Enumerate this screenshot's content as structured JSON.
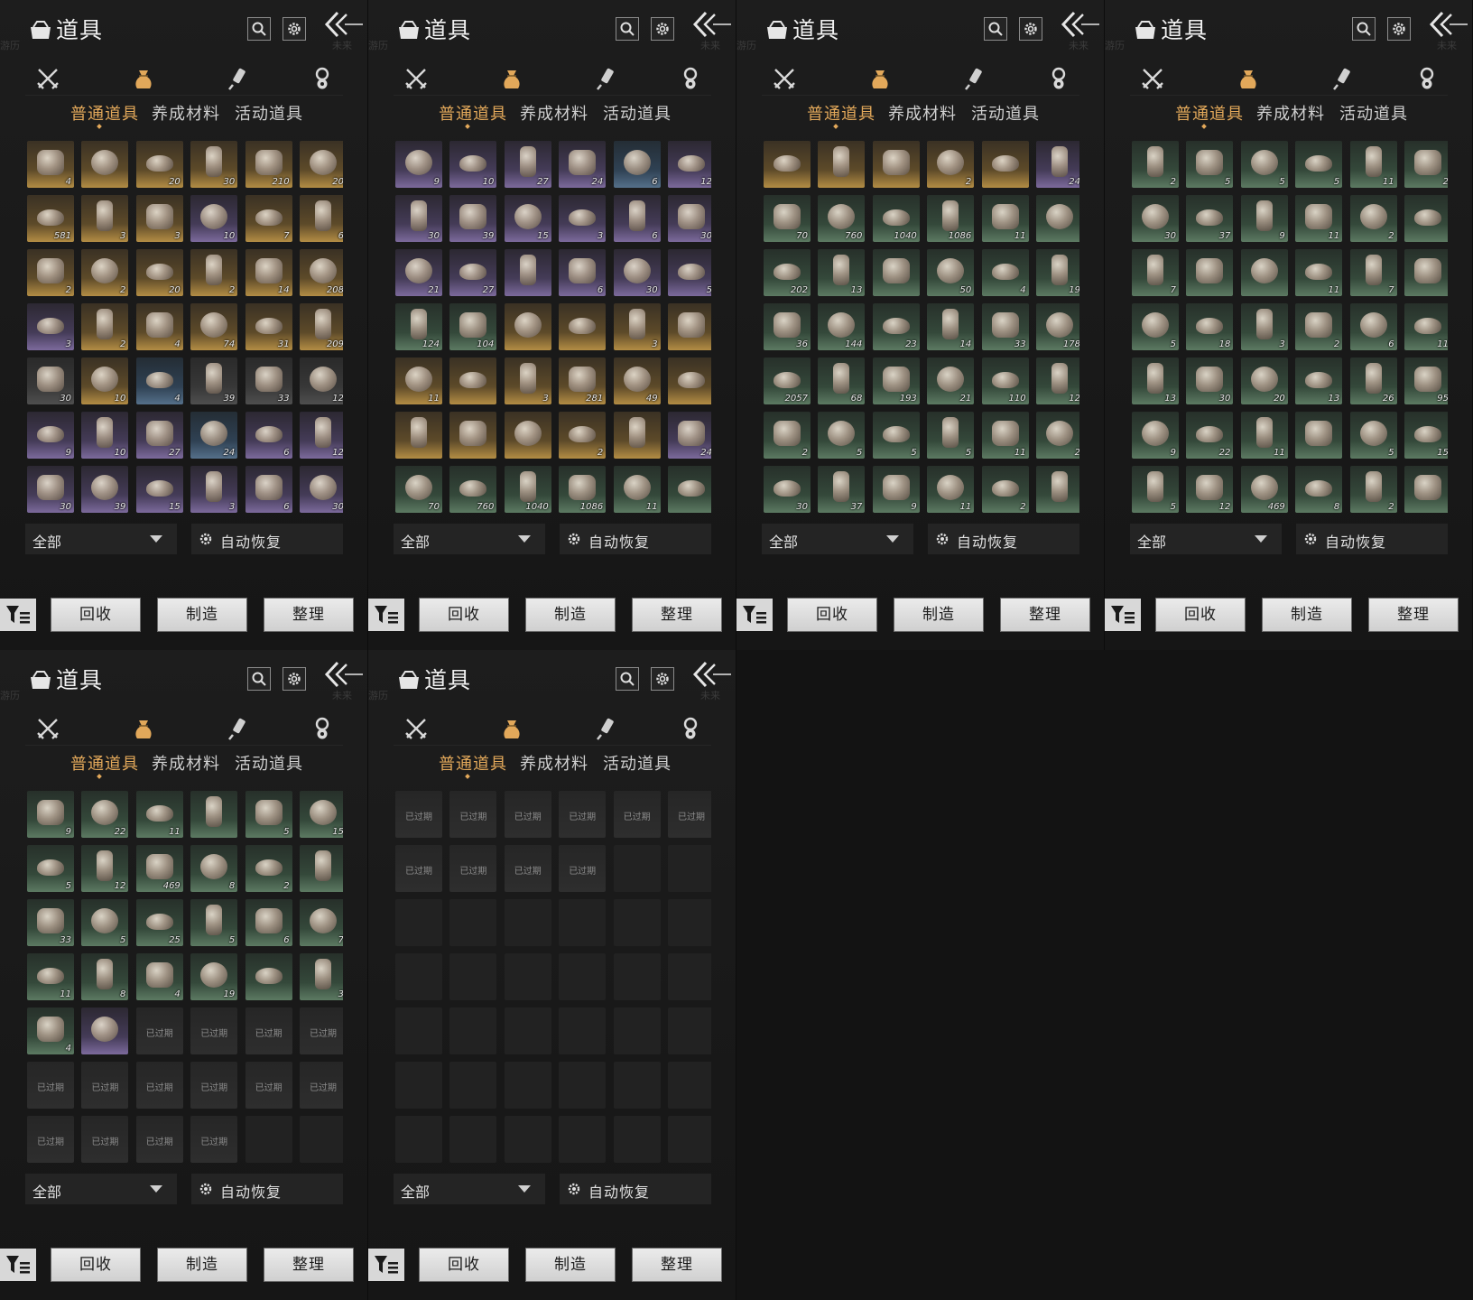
{
  "header": {
    "title": "道具",
    "faint_left": "游历",
    "faint_right": "未来"
  },
  "icons": {
    "bag": "bag-icon",
    "search": "search-icon",
    "settings": "gear-icon",
    "back": "double-chevron-left-icon",
    "cat_weapons": "crossed-swords-icon",
    "cat_items": "pouch-icon",
    "cat_scroll": "scroll-brush-icon",
    "cat_medal": "medal-icon",
    "filter": "filter-icon",
    "auto_recover": "gear-icon"
  },
  "subtabs": [
    "普通道具",
    "养成材料",
    "活动道具"
  ],
  "controls": {
    "dropdown_value": "全部",
    "auto_recover": "自动恢复"
  },
  "actions": {
    "recycle": "回收",
    "craft": "制造",
    "sort": "整理"
  },
  "expired_label": "已过期",
  "colors": {
    "accent": "#e2a85a",
    "rarity_gold": "#b38d44",
    "rarity_purple": "#7c6a9c",
    "rarity_green": "#5c7a62",
    "rarity_blue": "#55708a"
  },
  "panels": [
    {
      "rows": [
        [
          [
            "gold",
            "4"
          ],
          [
            "gold",
            ""
          ],
          [
            "gold",
            "20"
          ],
          [
            "gold",
            "30"
          ],
          [
            "gold",
            "210"
          ],
          [
            "gold",
            "20"
          ]
        ],
        [
          [
            "gold",
            "581"
          ],
          [
            "gold",
            "3"
          ],
          [
            "gold",
            "3"
          ],
          [
            "purple",
            "10"
          ],
          [
            "gold",
            "7"
          ],
          [
            "gold",
            "6"
          ]
        ],
        [
          [
            "gold",
            "2"
          ],
          [
            "gold",
            "2"
          ],
          [
            "gold",
            "20"
          ],
          [
            "gold",
            "2"
          ],
          [
            "gold",
            "14"
          ],
          [
            "gold",
            "208"
          ]
        ],
        [
          [
            "purple",
            "3"
          ],
          [
            "gold",
            "2"
          ],
          [
            "gold",
            "4"
          ],
          [
            "gold",
            "74"
          ],
          [
            "gold",
            "31"
          ],
          [
            "gold",
            "209"
          ]
        ],
        [
          [
            "grey",
            "30"
          ],
          [
            "gold",
            "10"
          ],
          [
            "blue",
            "4"
          ],
          [
            "grey",
            "39"
          ],
          [
            "grey",
            "33"
          ],
          [
            "grey",
            "12"
          ]
        ],
        [
          [
            "purple",
            "9"
          ],
          [
            "purple",
            "10"
          ],
          [
            "purple",
            "27"
          ],
          [
            "blue",
            "24"
          ],
          [
            "purple",
            "6"
          ],
          [
            "purple",
            "12"
          ]
        ],
        [
          [
            "purple",
            "30"
          ],
          [
            "purple",
            "39"
          ],
          [
            "purple",
            "15"
          ],
          [
            "purple",
            "3"
          ],
          [
            "purple",
            "6"
          ],
          [
            "purple",
            "30"
          ]
        ]
      ]
    },
    {
      "rows": [
        [
          [
            "purple",
            "9"
          ],
          [
            "purple",
            "10"
          ],
          [
            "purple",
            "27"
          ],
          [
            "purple",
            "24"
          ],
          [
            "blue",
            "6"
          ],
          [
            "purple",
            "12"
          ]
        ],
        [
          [
            "purple",
            "30"
          ],
          [
            "purple",
            "39"
          ],
          [
            "purple",
            "15"
          ],
          [
            "purple",
            "3"
          ],
          [
            "purple",
            "6"
          ],
          [
            "purple",
            "30"
          ]
        ],
        [
          [
            "purple",
            "21"
          ],
          [
            "purple",
            "27"
          ],
          [
            "purple",
            ""
          ],
          [
            "purple",
            "6"
          ],
          [
            "purple",
            "30"
          ],
          [
            "purple",
            "5"
          ]
        ],
        [
          [
            "green",
            "124"
          ],
          [
            "green",
            "104"
          ],
          [
            "gold",
            ""
          ],
          [
            "gold",
            ""
          ],
          [
            "gold",
            "3"
          ],
          [
            "gold",
            ""
          ]
        ],
        [
          [
            "gold",
            "11"
          ],
          [
            "gold",
            ""
          ],
          [
            "gold",
            "3"
          ],
          [
            "gold",
            "281"
          ],
          [
            "gold",
            "49"
          ],
          [
            "gold",
            ""
          ]
        ],
        [
          [
            "gold",
            ""
          ],
          [
            "gold",
            ""
          ],
          [
            "gold",
            ""
          ],
          [
            "gold",
            "2"
          ],
          [
            "gold",
            ""
          ],
          [
            "purple",
            "24"
          ]
        ],
        [
          [
            "green",
            "70"
          ],
          [
            "green",
            "760"
          ],
          [
            "green",
            "1040"
          ],
          [
            "green",
            "1086"
          ],
          [
            "green",
            "11"
          ],
          [
            "green",
            ""
          ]
        ]
      ]
    },
    {
      "rows": [
        [
          [
            "gold",
            ""
          ],
          [
            "gold",
            ""
          ],
          [
            "gold",
            ""
          ],
          [
            "gold",
            "2"
          ],
          [
            "gold",
            ""
          ],
          [
            "purple",
            "24"
          ]
        ],
        [
          [
            "green",
            "70"
          ],
          [
            "green",
            "760"
          ],
          [
            "green",
            "1040"
          ],
          [
            "green",
            "1086"
          ],
          [
            "green",
            "11"
          ],
          [
            "green",
            ""
          ]
        ],
        [
          [
            "green",
            "202"
          ],
          [
            "green",
            "13"
          ],
          [
            "green",
            ""
          ],
          [
            "green",
            "50"
          ],
          [
            "green",
            "4"
          ],
          [
            "green",
            "19"
          ]
        ],
        [
          [
            "green",
            "36"
          ],
          [
            "green",
            "144"
          ],
          [
            "green",
            "23"
          ],
          [
            "green",
            "14"
          ],
          [
            "green",
            "33"
          ],
          [
            "green",
            "178"
          ]
        ],
        [
          [
            "green",
            "2057"
          ],
          [
            "green",
            "68"
          ],
          [
            "green",
            "193"
          ],
          [
            "green",
            "21"
          ],
          [
            "green",
            "110"
          ],
          [
            "green",
            "12"
          ]
        ],
        [
          [
            "green",
            "2"
          ],
          [
            "green",
            "5"
          ],
          [
            "green",
            "5"
          ],
          [
            "green",
            "5"
          ],
          [
            "green",
            "11"
          ],
          [
            "green",
            "2"
          ]
        ],
        [
          [
            "green",
            "30"
          ],
          [
            "green",
            "37"
          ],
          [
            "green",
            "9"
          ],
          [
            "green",
            "11"
          ],
          [
            "green",
            "2"
          ],
          [
            "green",
            ""
          ]
        ]
      ]
    },
    {
      "rows": [
        [
          [
            "green",
            "2"
          ],
          [
            "green",
            "5"
          ],
          [
            "green",
            "5"
          ],
          [
            "green",
            "5"
          ],
          [
            "green",
            "11"
          ],
          [
            "green",
            "2"
          ]
        ],
        [
          [
            "green",
            "30"
          ],
          [
            "green",
            "37"
          ],
          [
            "green",
            "9"
          ],
          [
            "green",
            "11"
          ],
          [
            "green",
            "2"
          ],
          [
            "green",
            ""
          ]
        ],
        [
          [
            "green",
            "7"
          ],
          [
            "green",
            ""
          ],
          [
            "green",
            ""
          ],
          [
            "green",
            "11"
          ],
          [
            "green",
            "7"
          ],
          [
            "green",
            ""
          ]
        ],
        [
          [
            "green",
            "5"
          ],
          [
            "green",
            "18"
          ],
          [
            "green",
            "3"
          ],
          [
            "green",
            "2"
          ],
          [
            "green",
            "6"
          ],
          [
            "green",
            "11"
          ]
        ],
        [
          [
            "green",
            "13"
          ],
          [
            "green",
            "30"
          ],
          [
            "green",
            "20"
          ],
          [
            "green",
            "13"
          ],
          [
            "green",
            "26"
          ],
          [
            "green",
            "95"
          ]
        ],
        [
          [
            "green",
            "9"
          ],
          [
            "green",
            "22"
          ],
          [
            "green",
            "11"
          ],
          [
            "green",
            ""
          ],
          [
            "green",
            "5"
          ],
          [
            "green",
            "15"
          ]
        ],
        [
          [
            "green",
            "5"
          ],
          [
            "green",
            "12"
          ],
          [
            "green",
            "469"
          ],
          [
            "green",
            "8"
          ],
          [
            "green",
            "2"
          ],
          [
            "green",
            ""
          ]
        ]
      ]
    },
    {
      "rows": [
        [
          [
            "green",
            "9"
          ],
          [
            "green",
            "22"
          ],
          [
            "green",
            "11"
          ],
          [
            "green",
            ""
          ],
          [
            "green",
            "5"
          ],
          [
            "green",
            "15"
          ]
        ],
        [
          [
            "green",
            "5"
          ],
          [
            "green",
            "12"
          ],
          [
            "green",
            "469"
          ],
          [
            "green",
            "8"
          ],
          [
            "green",
            "2"
          ],
          [
            "green",
            ""
          ]
        ],
        [
          [
            "green",
            "33"
          ],
          [
            "green",
            "5"
          ],
          [
            "green",
            "25"
          ],
          [
            "green",
            "5"
          ],
          [
            "green",
            "6"
          ],
          [
            "green",
            "7"
          ]
        ],
        [
          [
            "green",
            "11"
          ],
          [
            "green",
            "8"
          ],
          [
            "green",
            "4"
          ],
          [
            "green",
            "19"
          ],
          [
            "green",
            ""
          ],
          [
            "green",
            "3"
          ]
        ],
        [
          [
            "green",
            "4"
          ],
          [
            "purple",
            ""
          ],
          [
            "expired",
            ""
          ],
          [
            "expired",
            ""
          ],
          [
            "expired",
            ""
          ],
          [
            "expired",
            ""
          ]
        ],
        [
          [
            "expired",
            ""
          ],
          [
            "expired",
            ""
          ],
          [
            "expired",
            ""
          ],
          [
            "expired",
            ""
          ],
          [
            "expired",
            ""
          ],
          [
            "expired",
            ""
          ]
        ],
        [
          [
            "expired",
            ""
          ],
          [
            "expired",
            ""
          ],
          [
            "expired",
            ""
          ],
          [
            "expired",
            ""
          ],
          [
            "empty",
            ""
          ],
          [
            "empty",
            ""
          ]
        ]
      ]
    },
    {
      "rows": [
        [
          [
            "expired",
            ""
          ],
          [
            "expired",
            ""
          ],
          [
            "expired",
            ""
          ],
          [
            "expired",
            ""
          ],
          [
            "expired",
            ""
          ],
          [
            "expired",
            ""
          ]
        ],
        [
          [
            "expired",
            ""
          ],
          [
            "expired",
            ""
          ],
          [
            "expired",
            ""
          ],
          [
            "expired",
            ""
          ],
          [
            "empty",
            ""
          ],
          [
            "empty",
            ""
          ]
        ],
        [
          [
            "empty",
            ""
          ],
          [
            "empty",
            ""
          ],
          [
            "empty",
            ""
          ],
          [
            "empty",
            ""
          ],
          [
            "empty",
            ""
          ],
          [
            "empty",
            ""
          ]
        ],
        [
          [
            "empty",
            ""
          ],
          [
            "empty",
            ""
          ],
          [
            "empty",
            ""
          ],
          [
            "empty",
            ""
          ],
          [
            "empty",
            ""
          ],
          [
            "empty",
            ""
          ]
        ],
        [
          [
            "empty",
            ""
          ],
          [
            "empty",
            ""
          ],
          [
            "empty",
            ""
          ],
          [
            "empty",
            ""
          ],
          [
            "empty",
            ""
          ],
          [
            "empty",
            ""
          ]
        ],
        [
          [
            "empty",
            ""
          ],
          [
            "empty",
            ""
          ],
          [
            "empty",
            ""
          ],
          [
            "empty",
            ""
          ],
          [
            "empty",
            ""
          ],
          [
            "empty",
            ""
          ]
        ],
        [
          [
            "empty",
            ""
          ],
          [
            "empty",
            ""
          ],
          [
            "empty",
            ""
          ],
          [
            "empty",
            ""
          ],
          [
            "empty",
            ""
          ],
          [
            "empty",
            ""
          ]
        ]
      ]
    }
  ]
}
